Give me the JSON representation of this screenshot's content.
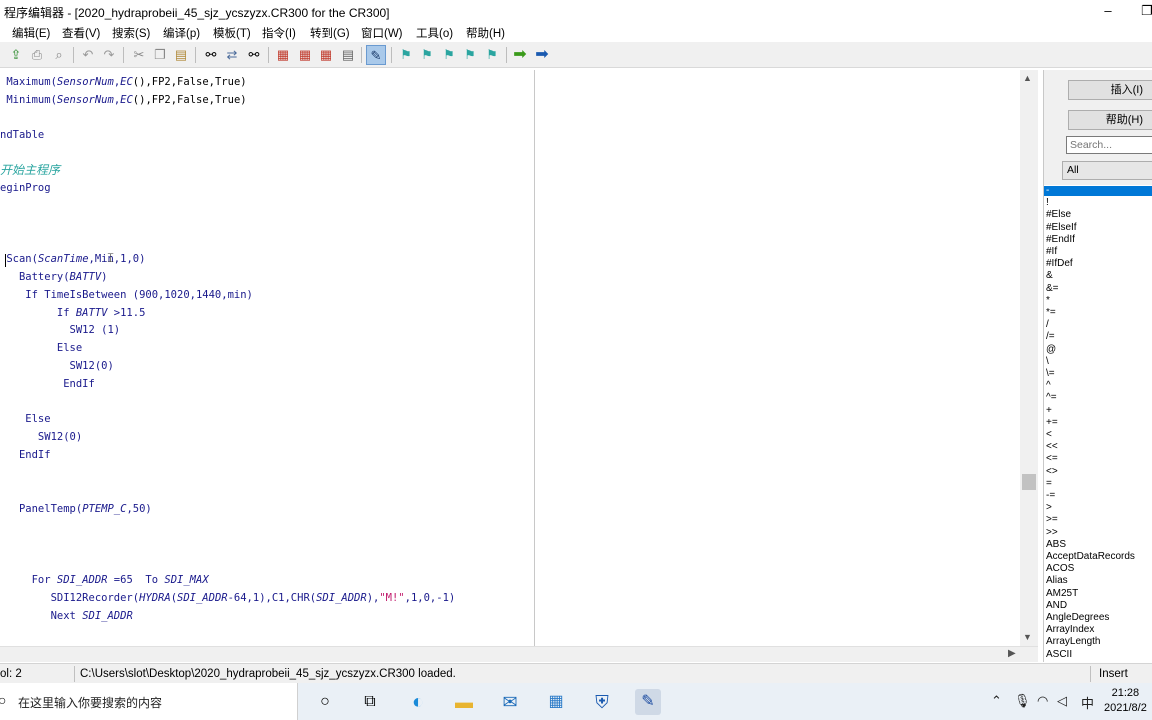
{
  "window": {
    "title": "程序编辑器 - [2020_hydraprobeii_45_sjz_ycszyzx.CR300 for the CR300]",
    "minimize_glyph": "–",
    "maximize_glyph": "❐"
  },
  "menu": [
    "编辑(E)",
    "查看(V)",
    "搜索(S)",
    "编译(p)",
    "模板(T)",
    "指令(I)",
    "转到(G)",
    "窗口(W)",
    "工具(o)",
    "帮助(H)"
  ],
  "code_lines": [
    " Maximum(SensorNum,EC(),FP2,False,True)",
    " Minimum(SensorNum,EC(),FP2,False,True)",
    "",
    "ndTable",
    "",
    "开始主程序",
    "eginProg",
    "",
    "",
    "",
    " Scan(ScanTime,Min,1,0)",
    "   Battery(BATTV)",
    "    If TimeIsBetween (900,1020,1440,min)",
    "         If BATTV >11.5",
    "           SW12 (1)",
    "         Else",
    "           SW12(0)",
    "          EndIf",
    "",
    "    Else",
    "      SW12(0)",
    "   EndIf",
    "",
    "",
    "",
    "   PanelTemp(PTEMP_C,50)",
    "",
    "",
    "",
    "     For SDI_ADDR =65  To SDI_MAX",
    "        SDI12Recorder(HYDRA(SDI_ADDR-64,1),C1,CHR(SDI_ADDR),\"M!\",1,0,-1)",
    "        Next SDI_ADDR"
  ],
  "right_panel": {
    "insert_button": "插入(I)",
    "help_button": "帮助(H)",
    "search_placeholder": "Search...",
    "filter_value": "All",
    "items": [
      "-",
      "!",
      "#Else",
      "#ElseIf",
      "#EndIf",
      "#If",
      "#IfDef",
      "&",
      "&=",
      "*",
      "*=",
      "/",
      "/=",
      "@",
      "\\",
      "\\=",
      "^",
      "^=",
      "+",
      "+=",
      "<",
      "<<",
      "<=",
      "<>",
      "=",
      "-=",
      ">",
      ">=",
      ">>",
      "ABS",
      "AcceptDataRecords",
      "ACOS",
      "Alias",
      "AM25T",
      "AND",
      "AngleDegrees",
      "ArrayIndex",
      "ArrayLength",
      "ASCII"
    ]
  },
  "status": {
    "col": "ol: 2",
    "message": "C:\\Users\\slot\\Desktop\\2020_hydraprobeii_45_sjz_ycszyzx.CR300 loaded.",
    "mode": "Insert"
  },
  "taskbar": {
    "search_placeholder": "在这里输入你要搜索的内容",
    "ime": "中",
    "time": "21:28",
    "date": "2021/8/2"
  },
  "colors": {
    "accent": "#0078d7",
    "keyword": "#1a1a8c",
    "string": "#c0186a",
    "comment": "#2aa5a0"
  }
}
